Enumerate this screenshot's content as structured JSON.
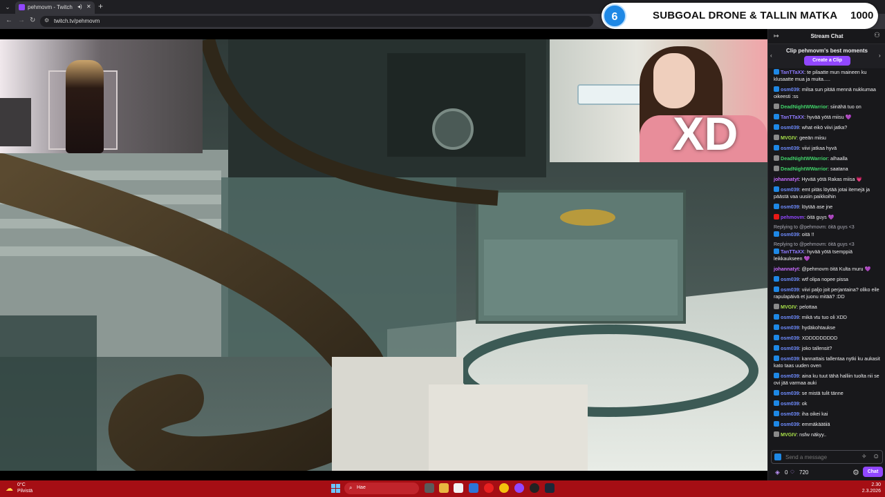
{
  "browser": {
    "tab_title": "pehmovm - Twitch",
    "url": "twitch.tv/pehmovm",
    "icons": [
      "tab-menu-icon",
      "audio-icon",
      "close-icon",
      "plus-icon",
      "back-icon",
      "forward-icon",
      "reload-icon",
      "site-info-icon"
    ]
  },
  "overlay": {
    "subgoal_number": "6",
    "subgoal_text": "SUBGOAL DRONE & TALLIN MATKA",
    "subgoal_count": "1000",
    "webcam_text": "XD"
  },
  "chat": {
    "title": "Stream Chat",
    "clip_title": "Clip pehmovm's best moments",
    "clip_button": "Create a Clip",
    "messages": [
      {
        "user": "TanTTaXX",
        "color": "#8f7bff",
        "badge": "#1e88e5",
        "text": "te pilaatte mun maineen ku klusaatte mua ja muita....."
      },
      {
        "user": "osm039",
        "color": "#6f8cff",
        "badge": "#1e88e5",
        "text": "milsa sun pitää mennä nukkumaa oikeesti :ss"
      },
      {
        "user": "DeadNightWWarrior",
        "color": "#41d46a",
        "badge": "#8a8a8a",
        "text": "siinähä tuo on"
      },
      {
        "user": "TanTTaXX",
        "color": "#8f7bff",
        "badge": "#1e88e5",
        "text": "hyvää yötä miisu 💜"
      },
      {
        "user": "osm039",
        "color": "#6f8cff",
        "badge": "#1e88e5",
        "text": "what eikö viivi jatka?"
      },
      {
        "user": "MVGIV",
        "color": "#a8e04a",
        "badge": "#8a8a8a",
        "text": "geeän miisu"
      },
      {
        "user": "osm039",
        "color": "#6f8cff",
        "badge": "#1e88e5",
        "text": "viivi jatkaa hyvä"
      },
      {
        "user": "DeadNightWWarrior",
        "color": "#41d46a",
        "badge": "#8a8a8a",
        "text": "alhaalla"
      },
      {
        "user": "DeadNightWWarrior",
        "color": "#41d46a",
        "badge": "#8a8a8a",
        "text": "saatana"
      },
      {
        "user": "johannatyt",
        "color": "#c86cff",
        "badge": "",
        "text": "Hyvää yötä Rakas miisa 💗"
      },
      {
        "user": "osm039",
        "color": "#6f8cff",
        "badge": "#1e88e5",
        "text": "emt pitäs löytää jotai itemejä ja päästä vaa uusiin paikkoihin"
      },
      {
        "user": "osm039",
        "color": "#6f8cff",
        "badge": "#1e88e5",
        "text": "löytää ase jne"
      },
      {
        "user": "pehmovm",
        "color": "#9147ff",
        "badge": "#e91916",
        "text": "öitä guys 💜"
      },
      {
        "reply": "Replying to @pehmovm: öitä guys <3",
        "user": "osm039",
        "color": "#6f8cff",
        "badge": "#1e88e5",
        "text": "oitä !!"
      },
      {
        "reply": "Replying to @pehmovm: öitä guys <3",
        "user": "TanTTaXX",
        "color": "#8f7bff",
        "badge": "#1e88e5",
        "text": "hyvää yötä tsemppiä leikkaukseen 💜"
      },
      {
        "user": "johannatyt",
        "color": "#c86cff",
        "badge": "",
        "text": "@pehmovm öitä Kulta muru 💜"
      },
      {
        "user": "osm039",
        "color": "#6f8cff",
        "badge": "#1e88e5",
        "text": "wtf olipa nopee pissa"
      },
      {
        "user": "osm039",
        "color": "#6f8cff",
        "badge": "#1e88e5",
        "text": "viivi paljo joit perjantaina? oliko eile rapulapäivä et juonu mitää? :DD"
      },
      {
        "user": "MVGIV",
        "color": "#a8e04a",
        "badge": "#8a8a8a",
        "text": "pelottaa"
      },
      {
        "user": "osm039",
        "color": "#6f8cff",
        "badge": "#1e88e5",
        "text": "mikä vtu tuo oli XDD"
      },
      {
        "user": "osm039",
        "color": "#6f8cff",
        "badge": "#1e88e5",
        "text": "hydäkohtaukse"
      },
      {
        "user": "osm039",
        "color": "#6f8cff",
        "badge": "#1e88e5",
        "text": "XDDDDDDDDD"
      },
      {
        "user": "osm039",
        "color": "#6f8cff",
        "badge": "#1e88e5",
        "text": "joko tallensit?"
      },
      {
        "user": "osm039",
        "color": "#6f8cff",
        "badge": "#1e88e5",
        "text": "kannattais tallentaa nytki ku aukasit kato taas uuden oven"
      },
      {
        "user": "osm039",
        "color": "#6f8cff",
        "badge": "#1e88e5",
        "text": "aina ku tuut tähä halliin tuolta nii se ovi jää varmaa auki"
      },
      {
        "user": "osm039",
        "color": "#6f8cff",
        "badge": "#1e88e5",
        "text": "se mistä tulit tänne"
      },
      {
        "user": "osm039",
        "color": "#6f8cff",
        "badge": "#1e88e5",
        "text": "ok"
      },
      {
        "user": "osm039",
        "color": "#6f8cff",
        "badge": "#1e88e5",
        "text": "iha oikei kai"
      },
      {
        "user": "osm039",
        "color": "#6f8cff",
        "badge": "#1e88e5",
        "text": "emmäkäätiiä"
      },
      {
        "user": "MVGIV",
        "color": "#a8e04a",
        "badge": "#8a8a8a",
        "text": "nsfw näkyy.."
      }
    ],
    "input_placeholder": "Send a message",
    "points": "0",
    "viewers": "720",
    "chat_button": "Chat"
  },
  "taskbar": {
    "temp": "0°C",
    "weather": "Pilvistä",
    "search_placeholder": "Hae",
    "time": "2.30",
    "date": "2.3.2026"
  }
}
